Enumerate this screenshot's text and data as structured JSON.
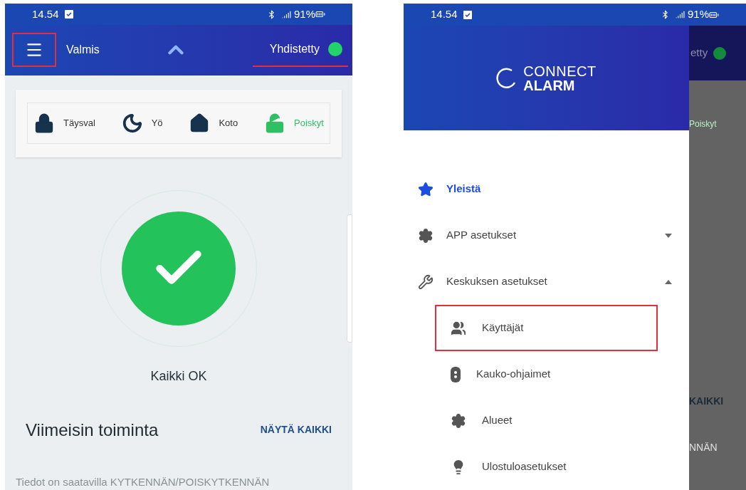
{
  "screens": [
    {
      "status_bar": {
        "time": "14.54",
        "battery": "91%"
      },
      "app_bar": {
        "state": "Valmis",
        "connection": "Yhdistetty",
        "connected": true,
        "menu_annotated": true,
        "connection_annotated": true
      },
      "modes": [
        {
          "label": "Täysval",
          "kind": "lock",
          "selected": false
        },
        {
          "label": "Yö",
          "kind": "night",
          "selected": false
        },
        {
          "label": "Koto",
          "kind": "home",
          "selected": false
        },
        {
          "label": "Poiskyt",
          "kind": "unlock",
          "selected": true
        }
      ],
      "status": {
        "text": "Kaikki OK",
        "ok": true
      },
      "recent": {
        "title": "Viimeisin toiminta",
        "link": "NÄYTÄ KAIKKI",
        "info": "Tiedot on saatavilla KYTKENNÄN/POISKYTKENNÄN"
      }
    },
    {
      "status_bar": {
        "time": "14.54",
        "battery": "91%"
      },
      "drawer": {
        "logo_top": "CONNECT",
        "logo_bottom": "ALARM",
        "items": [
          {
            "label": "Yleistä",
            "kind": "star",
            "selected": true
          },
          {
            "label": "APP asetukset",
            "kind": "gear",
            "selected": false,
            "expanded": false
          },
          {
            "label": "Keskuksen asetukset",
            "kind": "wrench",
            "selected": false,
            "expanded": true,
            "children": [
              {
                "label": "Käyttäjät",
                "kind": "users",
                "selected": false,
                "annotated": true
              },
              {
                "label": "Kauko-ohjaimet",
                "kind": "remote",
                "selected": false,
                "annotated": false
              },
              {
                "label": "Alueet",
                "kind": "gear",
                "selected": false,
                "annotated": false
              },
              {
                "label": "Ulostuloasetukset",
                "kind": "bulb",
                "selected": false,
                "annotated": false
              }
            ]
          }
        ]
      },
      "behind_drawer": {
        "connection": "etty",
        "connected": true,
        "mode": "Poiskyt",
        "link": "KAIKKI",
        "info": "NNÄN"
      }
    }
  ]
}
